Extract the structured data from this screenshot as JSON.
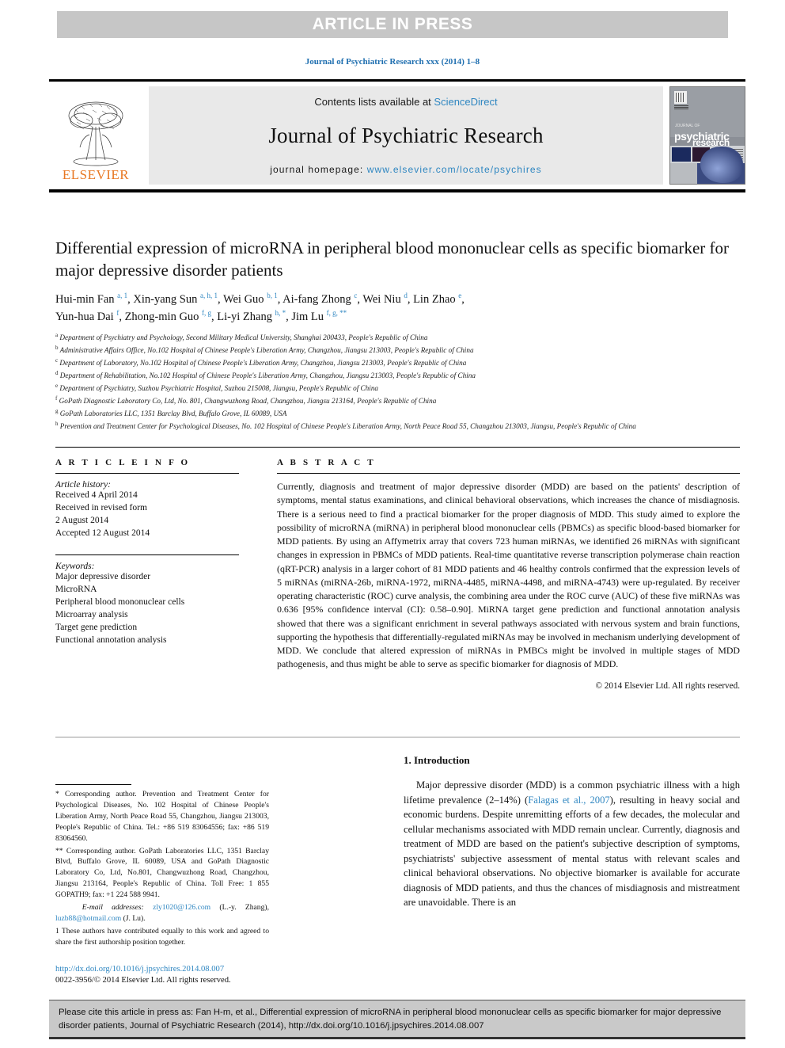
{
  "banner": {
    "text": "ARTICLE IN PRESS"
  },
  "running_head": "Journal of Psychiatric Research xxx (2014) 1–8",
  "masthead": {
    "contents_prefix": "Contents lists available at ",
    "sciencedirect": "ScienceDirect",
    "journal_title": "Journal of Psychiatric Research",
    "homepage_label": "journal homepage: ",
    "homepage_url": "www.elsevier.com/locate/psychires",
    "publisher": "ELSEVIER",
    "cover": {
      "kicker": "JOURNAL OF",
      "line1": "psychiatric",
      "line2": "research"
    }
  },
  "article": {
    "title": "Differential expression of microRNA in peripheral blood mononuclear cells as specific biomarker for major depressive disorder patients",
    "authors_line_1": "Hui-min Fan a, 1, Xin-yang Sun a, h, 1, Wei Guo b, 1, Ai-fang Zhong c, Wei Niu d, Lin Zhao e,",
    "authors_line_2": "Yun-hua Dai f, Zhong-min Guo f, g, Li-yi Zhang h, *, Jim Lu f, g, **",
    "affiliations": [
      {
        "sup": "a",
        "text": "Department of Psychiatry and Psychology, Second Military Medical University, Shanghai 200433, People's Republic of China"
      },
      {
        "sup": "b",
        "text": "Administrative Affairs Office, No.102 Hospital of Chinese People's Liberation Army, Changzhou, Jiangsu 213003, People's Republic of China"
      },
      {
        "sup": "c",
        "text": "Department of Laboratory, No.102 Hospital of Chinese People's Liberation Army, Changzhou, Jiangsu 213003, People's Republic of China"
      },
      {
        "sup": "d",
        "text": "Department of Rehabilitation, No.102 Hospital of Chinese People's Liberation Army, Changzhou, Jiangsu 213003, People's Republic of China"
      },
      {
        "sup": "e",
        "text": "Department of Psychiatry, Suzhou Psychiatric Hospital, Suzhou 215008, Jiangsu, People's Republic of China"
      },
      {
        "sup": "f",
        "text": "GoPath Diagnostic Laboratory Co, Ltd, No. 801, Changwuzhong Road, Changzhou, Jiangsu 213164, People's Republic of China"
      },
      {
        "sup": "g",
        "text": "GoPath Laboratories LLC, 1351 Barclay Blvd, Buffalo Grove, IL 60089, USA"
      },
      {
        "sup": "h",
        "text": "Prevention and Treatment Center for Psychological Diseases, No. 102 Hospital of Chinese People's Liberation Army, North Peace Road 55, Changzhou 213003, Jiangsu, People's Republic of China"
      }
    ]
  },
  "article_info": {
    "heading": "A R T I C L E  I N F O",
    "history_label": "Article history:",
    "history": [
      "Received 4 April 2014",
      "Received in revised form",
      "2 August 2014",
      "Accepted 12 August 2014"
    ],
    "keywords_label": "Keywords:",
    "keywords": [
      "Major depressive disorder",
      "MicroRNA",
      "Peripheral blood mononuclear cells",
      "Microarray analysis",
      "Target gene prediction",
      "Functional annotation analysis"
    ]
  },
  "abstract": {
    "heading": "A B S T R A C T",
    "body": "Currently, diagnosis and treatment of major depressive disorder (MDD) are based on the patients' description of symptoms, mental status examinations, and clinical behavioral observations, which increases the chance of misdiagnosis. There is a serious need to find a practical biomarker for the proper diagnosis of MDD. This study aimed to explore the possibility of microRNA (miRNA) in peripheral blood mononuclear cells (PBMCs) as specific blood-based biomarker for MDD patients. By using an Affymetrix array that covers 723 human miRNAs, we identified 26 miRNAs with significant changes in expression in PBMCs of MDD patients. Real-time quantitative reverse transcription polymerase chain reaction (qRT-PCR) analysis in a larger cohort of 81 MDD patients and 46 healthy controls confirmed that the expression levels of 5 miRNAs (miRNA-26b, miRNA-1972, miRNA-4485, miRNA-4498, and miRNA-4743) were up-regulated. By receiver operating characteristic (ROC) curve analysis, the combining area under the ROC curve (AUC) of these five miRNAs was 0.636 [95% confidence interval (CI): 0.58–0.90]. MiRNA target gene prediction and functional annotation analysis showed that there was a significant enrichment in several pathways associated with nervous system and brain functions, supporting the hypothesis that differentially-regulated miRNAs may be involved in mechanism underlying development of MDD. We conclude that altered expression of miRNAs in PMBCs might be involved in multiple stages of MDD pathogenesis, and thus might be able to serve as specific biomarker for diagnosis of MDD.",
    "copyright": "© 2014 Elsevier Ltd. All rights reserved."
  },
  "footnotes": {
    "corresponding_1": "* Corresponding author. Prevention and Treatment Center for Psychological Diseases, No. 102 Hospital of Chinese People's Liberation Army, North Peace Road 55, Changzhou, Jiangsu 213003, People's Republic of China. Tel.: +86 519 83064556; fax: +86 519 83064560.",
    "corresponding_2": "** Corresponding author. GoPath Laboratories LLC, 1351 Barclay Blvd, Buffalo Grove, IL 60089, USA and GoPath Diagnostic Laboratory Co, Ltd, No.801, Changwuzhong Road, Changzhou, Jiangsu 213164, People's Republic of China. Toll Free: 1 855 GOPATH9; fax: +1 224 588 9941.",
    "email_label": "E-mail addresses:",
    "email_1": "zly1020@126.com",
    "email_1_name": "(L.-y. Zhang),",
    "email_2": "luzb88@hotmail.com",
    "email_2_name": "(J. Lu).",
    "equal_contribution": "1 These authors have contributed equally to this work and agreed to share the first authorship position together."
  },
  "doi_url": "http://dx.doi.org/10.1016/j.jpsychires.2014.08.007",
  "issn_line": "0022-3956/© 2014 Elsevier Ltd. All rights reserved.",
  "introduction": {
    "heading": "1. Introduction",
    "para_1_a": "Major depressive disorder (MDD) is a common psychiatric illness with a high lifetime prevalence (2–14%) (",
    "reference_1": "Falagas et al., 2007",
    "para_1_b": "), resulting in heavy social and economic burdens. Despite unremitting efforts of a few decades, the molecular and cellular mechanisms associated with MDD remain unclear. Currently, diagnosis and treatment of MDD are based on the patient's subjective description of symptoms, psychiatrists' subjective assessment of mental status with relevant scales and clinical behavioral observations. No objective biomarker is available for accurate diagnosis of MDD patients, and thus the chances of misdiagnosis and mistreatment are unavoidable. There is an"
  },
  "citation_footer": {
    "text": "Please cite this article in press as: Fan H-m, et al., Differential expression of microRNA in peripheral blood mononuclear cells as specific biomarker for major depressive disorder patients, Journal of Psychiatric Research (2014), http://dx.doi.org/10.1016/j.jpsychires.2014.08.007"
  },
  "colors": {
    "link": "#2e86c1",
    "elsevier_orange": "#e87722",
    "banner_gray": "#c6c6c6"
  }
}
